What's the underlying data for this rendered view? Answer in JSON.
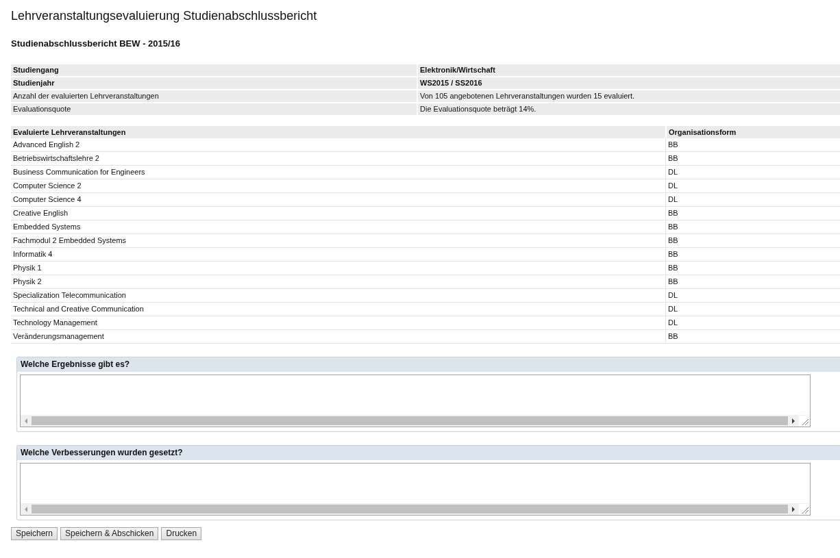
{
  "title": "Lehrveranstaltungsevaluierung Studienabschlussbericht",
  "subtitle": "Studienabschlussbericht BEW - 2015/16",
  "summary": [
    {
      "label": "Studiengang",
      "value": "Elektronik/Wirtschaft",
      "bold": true
    },
    {
      "label": "Studienjahr",
      "value": "WS2015 / SS2016",
      "bold": true
    },
    {
      "label": "Anzahl der evaluierten Lehrveranstaltungen",
      "value": "Von 105 angebotenen Lehrveranstaltungen wurden 15 evaluiert.",
      "bold": false
    },
    {
      "label": "Evaluationsquote",
      "value": "Die Evaluationsquote beträgt 14%.",
      "bold": false
    }
  ],
  "courses_table": {
    "columns": [
      "Evaluierte Lehrveranstaltungen",
      "Organisationsform"
    ],
    "rows": [
      [
        "Advanced English 2",
        "BB"
      ],
      [
        "Betriebswirtschaftslehre 2",
        "BB"
      ],
      [
        "Business Communication for Engineers",
        "DL"
      ],
      [
        "Computer Science 2",
        "DL"
      ],
      [
        "Computer Science 4",
        "DL"
      ],
      [
        "Creative English",
        "BB"
      ],
      [
        "Embedded Systems",
        "BB"
      ],
      [
        "Fachmodul 2 Embedded Systems",
        "BB"
      ],
      [
        "Informatik 4",
        "BB"
      ],
      [
        "Physik 1",
        "BB"
      ],
      [
        "Physik 2",
        "BB"
      ],
      [
        "Specialization Telecommunication",
        "DL"
      ],
      [
        "Technical and Creative Communication",
        "DL"
      ],
      [
        "Technology Management",
        "DL"
      ],
      [
        "Veränderungsmanagement",
        "BB"
      ]
    ]
  },
  "questions": [
    {
      "label": "Welche Ergebnisse gibt es?"
    },
    {
      "label": "Welche Verbesserungen wurden gesetzt?"
    }
  ],
  "buttons": [
    "Speichern",
    "Speichern & Abschicken",
    "Drucken"
  ]
}
